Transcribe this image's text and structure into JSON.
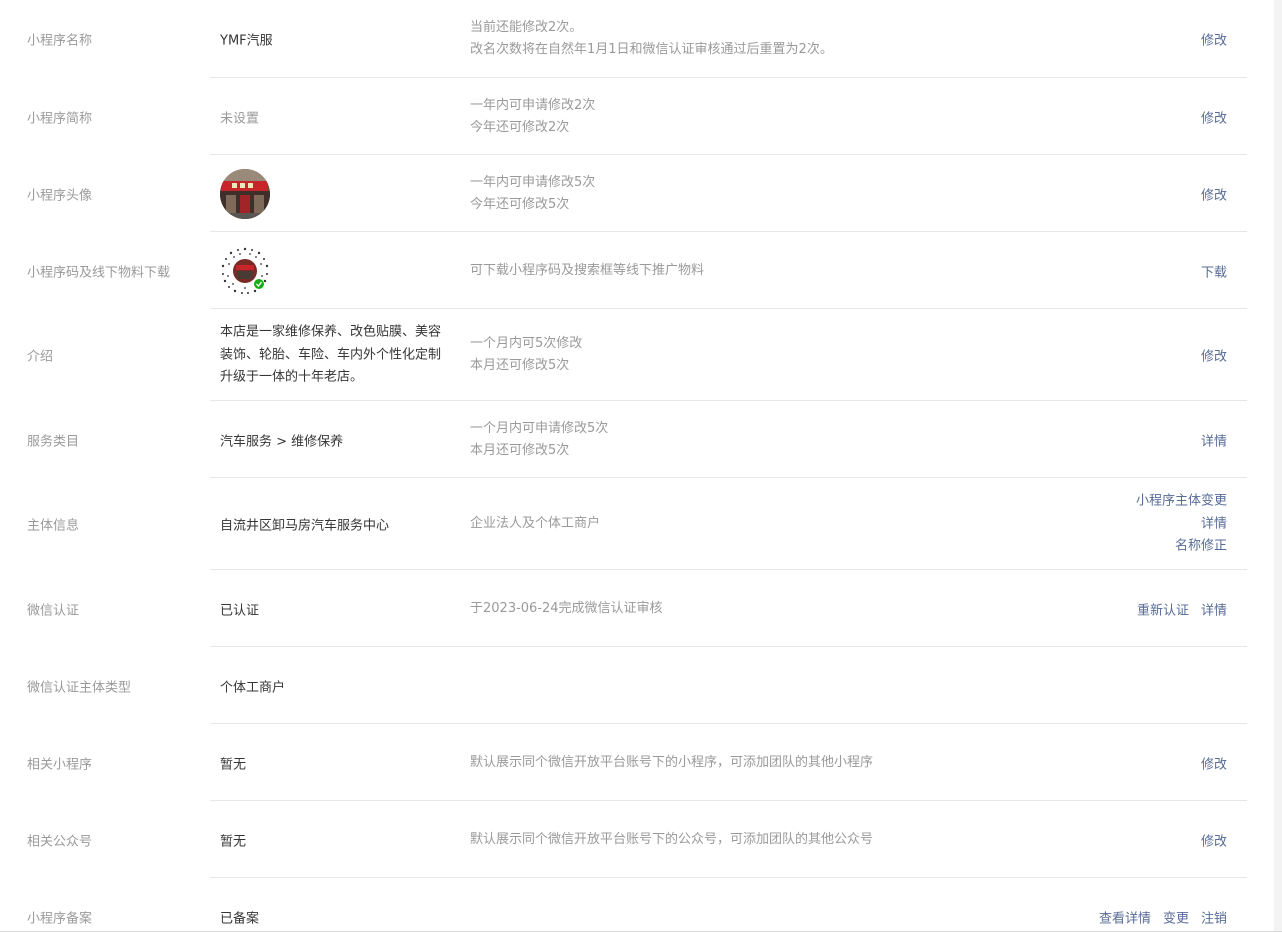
{
  "rows": [
    {
      "label": "小程序名称",
      "value": "YMF汽服",
      "desc": [
        "当前还能修改2次。",
        "改名次数将在自然年1月1日和微信认证审核通过后重置为2次。"
      ],
      "actions": [
        "修改"
      ]
    },
    {
      "label": "小程序简称",
      "value": "未设置",
      "desc": [
        "一年内可申请修改2次",
        "今年还可修改2次"
      ],
      "actions": [
        "修改"
      ]
    },
    {
      "label": "小程序头像",
      "value": "",
      "desc": [
        "一年内可申请修改5次",
        "今年还可修改5次"
      ],
      "actions": [
        "修改"
      ]
    },
    {
      "label": "小程序码及线下物料下载",
      "value": "",
      "desc": [
        "可下载小程序码及搜索框等线下推广物料"
      ],
      "actions": [
        "下载"
      ]
    },
    {
      "label": "介绍",
      "value": "本店是一家维修保养、改色贴膜、美容装饰、轮胎、车险、车内外个性化定制升级于一体的十年老店。",
      "desc": [
        "一个月内可5次修改",
        "本月还可修改5次"
      ],
      "actions": [
        "修改"
      ]
    },
    {
      "label": "服务类目",
      "value": "汽车服务 > 维修保养",
      "desc": [
        "一个月内可申请修改5次",
        "本月还可修改5次"
      ],
      "actions": [
        "详情"
      ]
    },
    {
      "label": "主体信息",
      "value": "自流井区卸马房汽车服务中心",
      "desc": [
        "企业法人及个体工商户"
      ],
      "actions": [
        "小程序主体变更",
        "详情",
        "名称修正"
      ]
    },
    {
      "label": "微信认证",
      "value": "已认证",
      "desc": [
        "于2023-06-24完成微信认证审核"
      ],
      "actions": [
        "重新认证",
        "详情"
      ]
    },
    {
      "label": "微信认证主体类型",
      "value": "个体工商户",
      "desc": [],
      "actions": []
    },
    {
      "label": "相关小程序",
      "value": "暂无",
      "desc": [
        "默认展示同个微信开放平台账号下的小程序，可添加团队的其他小程序"
      ],
      "actions": [
        "修改"
      ]
    },
    {
      "label": "相关公众号",
      "value": "暂无",
      "desc": [
        "默认展示同个微信开放平台账号下的公众号，可添加团队的其他公众号"
      ],
      "actions": [
        "修改"
      ]
    },
    {
      "label": "小程序备案",
      "value": "已备案",
      "desc": [],
      "actions": [
        "查看详情",
        "变更",
        "注销"
      ]
    }
  ],
  "colors": {
    "label": "#9a9a9a",
    "value": "#353535",
    "link": "#576b95",
    "divider": "#e7e7eb"
  },
  "icons": {
    "avatar": "store-front-avatar",
    "qrcode": "mini-program-code"
  }
}
